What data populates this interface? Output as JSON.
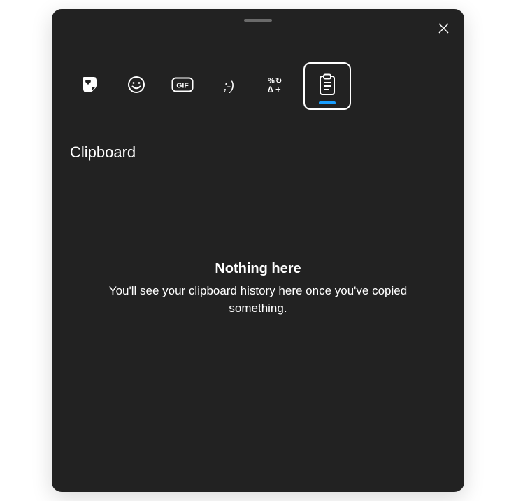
{
  "panel": {
    "section_title": "Clipboard",
    "empty_state": {
      "title": "Nothing here",
      "message": "You'll see your clipboard history here once you've copied something."
    }
  },
  "tabs": [
    {
      "id": "recent",
      "icon": "sticker-heart-icon",
      "selected": false
    },
    {
      "id": "emoji",
      "icon": "smiley-icon",
      "selected": false
    },
    {
      "id": "gif",
      "icon": "gif-icon",
      "selected": false
    },
    {
      "id": "kaomoji",
      "icon": "kaomoji-icon",
      "selected": false,
      "label": ";-)"
    },
    {
      "id": "symbols",
      "icon": "symbols-icon",
      "selected": false
    },
    {
      "id": "clipboard",
      "icon": "clipboard-icon",
      "selected": true
    }
  ],
  "colors": {
    "background": "#222222",
    "accent": "#1a9fff",
    "text": "#ffffff"
  }
}
